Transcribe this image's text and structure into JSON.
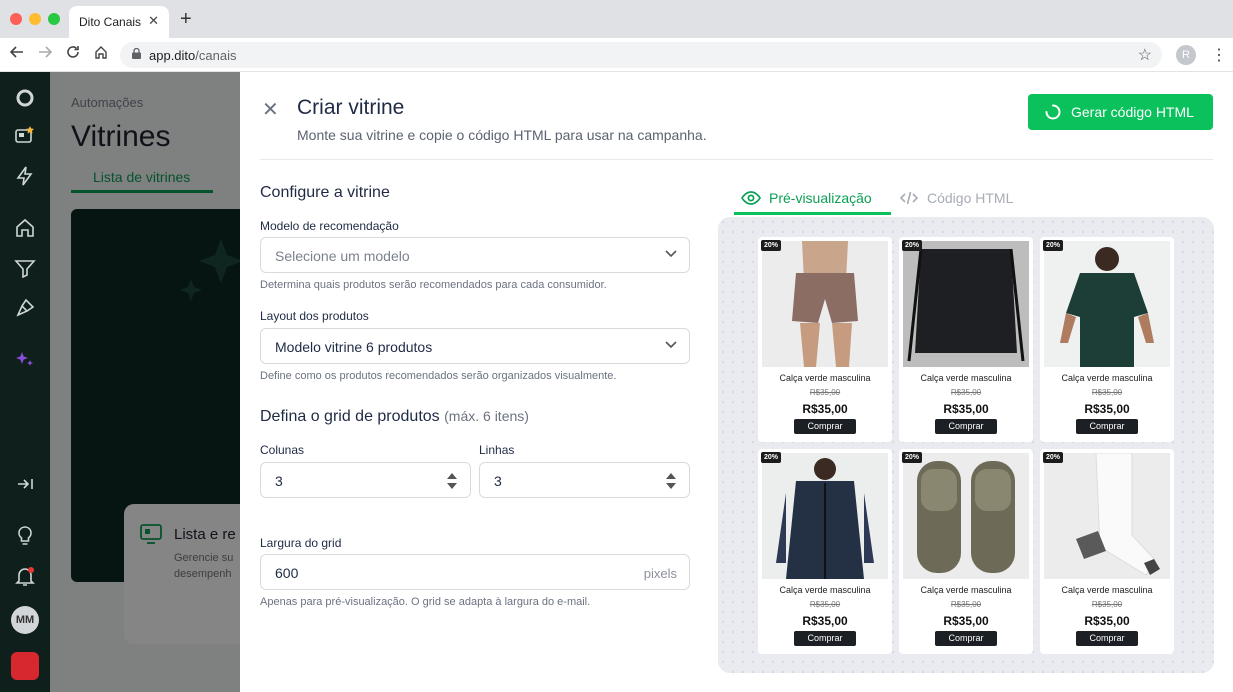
{
  "browser": {
    "tab_title": "Dito Canais",
    "tab_close": "✕",
    "new_tab": "+",
    "url_host": "app.dito",
    "url_path": "/canais",
    "profile_initial": "R"
  },
  "sidebar": {
    "avatar_initials": "MM"
  },
  "background_page": {
    "breadcrumb": "Automações",
    "title": "Vitrines",
    "tab": "Lista de vitrines",
    "card_title": "Lista e re",
    "card_desc": "Gerencie su\ndesempenh"
  },
  "drawer": {
    "title": "Criar vitrine",
    "subtitle": "Monte sua vitrine e copie o código HTML para usar na campanha.",
    "generate_button": "Gerar código HTML",
    "configure_title": "Configure a vitrine",
    "model": {
      "label": "Modelo de recomendação",
      "placeholder": "Selecione um modelo",
      "help": "Determina quais produtos serão recomendados para cada consumidor."
    },
    "layout": {
      "label": "Layout dos produtos",
      "value": "Modelo vitrine 6 produtos",
      "help": "Define como os produtos recomendados serão organizados visualmente."
    },
    "grid": {
      "title": "Defina o grid de produtos",
      "hint": "(máx. 6 itens)",
      "columns_label": "Colunas",
      "columns_value": "3",
      "rows_label": "Linhas",
      "rows_value": "3",
      "width_label": "Largura do grid",
      "width_value": "600",
      "width_unit": "pixels",
      "width_help": "Apenas para pré-visualização. O grid se adapta à largura do e-mail."
    },
    "preview_tabs": {
      "preview": "Pré-visualização",
      "code": "Código HTML"
    }
  },
  "products": [
    {
      "badge": "20%",
      "name": "Calça verde masculina",
      "old_price": "R$35,00",
      "price": "R$35,00",
      "buy": "Comprar",
      "image": "shorts"
    },
    {
      "badge": "20%",
      "name": "Calça verde masculina",
      "old_price": "R$35,00",
      "price": "R$35,00",
      "buy": "Comprar",
      "image": "drawstring-bag"
    },
    {
      "badge": "20%",
      "name": "Calça verde masculina",
      "old_price": "R$35,00",
      "price": "R$35,00",
      "buy": "Comprar",
      "image": "polo-shirt"
    },
    {
      "badge": "20%",
      "name": "Calça verde masculina",
      "old_price": "R$35,00",
      "price": "R$35,00",
      "buy": "Comprar",
      "image": "puffer-vest"
    },
    {
      "badge": "20%",
      "name": "Calça verde masculina",
      "old_price": "R$35,00",
      "price": "R$35,00",
      "buy": "Comprar",
      "image": "slides"
    },
    {
      "badge": "20%",
      "name": "Calça verde masculina",
      "old_price": "R$35,00",
      "price": "R$35,00",
      "buy": "Comprar",
      "image": "sock"
    }
  ],
  "colors": {
    "accent": "#0bc15c",
    "sidebar": "#0e1f1c",
    "title": "#1f2a44"
  }
}
